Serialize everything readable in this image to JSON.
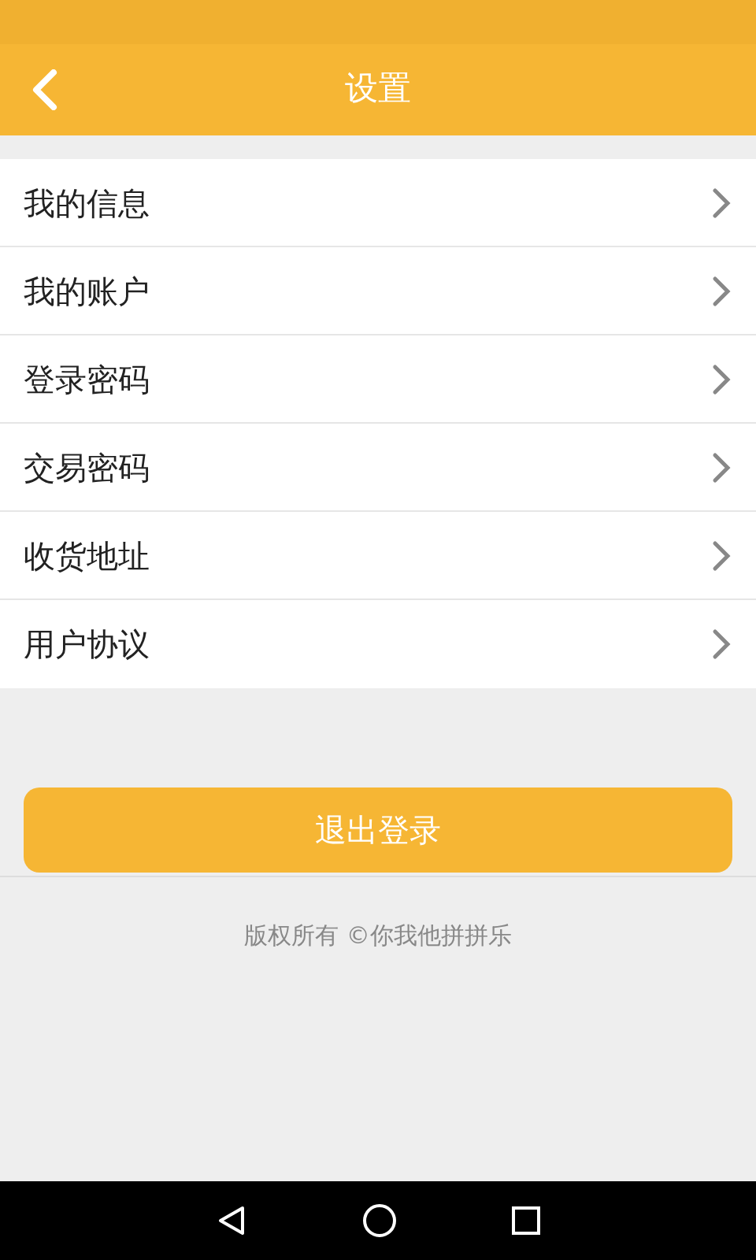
{
  "header": {
    "title": "设置"
  },
  "menu_items": [
    {
      "label": "我的信息"
    },
    {
      "label": "我的账户"
    },
    {
      "label": "登录密码"
    },
    {
      "label": "交易密码"
    },
    {
      "label": "收货地址"
    },
    {
      "label": "用户协议"
    }
  ],
  "logout_button": {
    "label": "退出登录"
  },
  "footer": {
    "copyright": "版权所有 ©你我他拼拼乐"
  }
}
